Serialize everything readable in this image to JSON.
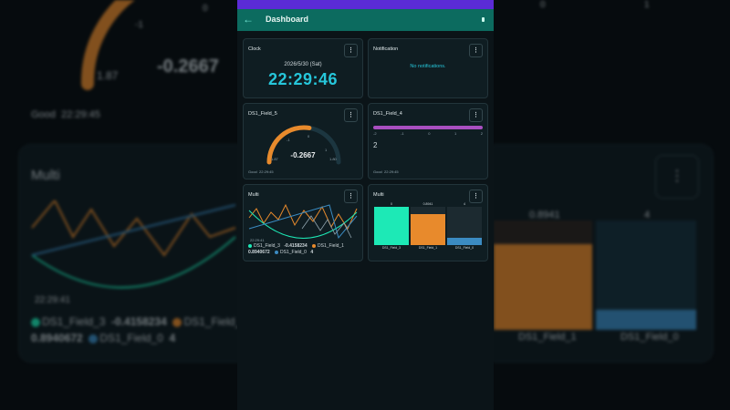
{
  "app": {
    "title": "Dashboard"
  },
  "colors": {
    "teal": "#1de9b6",
    "orange": "#e88a2c",
    "blue": "#3b8bc2",
    "purple": "#a94fc0",
    "accent": "#26c6da"
  },
  "clock": {
    "title": "Clock",
    "date": "2026/5/30 (Sat)",
    "time": "22:29:46"
  },
  "notification": {
    "title": "Notification",
    "empty": "No notifications."
  },
  "gauge": {
    "title": "DS1_Field_5",
    "value": "-0.2667",
    "min": "1.87",
    "max": "1.80",
    "tick_a": "-1",
    "tick_b": "0",
    "tick_c": "1",
    "status": "Good",
    "timestamp": "22:29:45",
    "level": 0.55
  },
  "bar_field": {
    "title": "DS1_Field_4",
    "value": "2",
    "ticks": [
      "-2",
      "-1",
      "0",
      "1",
      "2"
    ],
    "status": "Good",
    "timestamp": "22:29:45"
  },
  "multi_line": {
    "title": "Multi",
    "time_label": "22:29:41",
    "legend": [
      {
        "name": "DS1_Field_3",
        "value": "-0.4158234",
        "color": "#1de9b6"
      },
      {
        "name": "DS1_Field_1",
        "value": "0.8940672",
        "color": "#e88a2c"
      },
      {
        "name": "DS1_Field_0",
        "value": "4",
        "color": "#3b8bc2"
      }
    ]
  },
  "multi_bar": {
    "title": "Multi",
    "bars": [
      {
        "label": "DS1_Field_3",
        "value_label": "0",
        "color": "#1de9b6",
        "fill": 1.0
      },
      {
        "label": "DS1_Field_1",
        "value_label": "0.8941",
        "color": "#e88a2c",
        "fill": 0.8
      },
      {
        "label": "DS1_Field_0",
        "value_label": "4",
        "color": "#3b8bc2",
        "fill": 0.2
      }
    ]
  },
  "background": {
    "gauge_min": "1.87",
    "gauge_tick": "-1",
    "gauge_tick_top": "0",
    "value": "-0.2667",
    "status": "Good",
    "timestamp": "22:29:45",
    "multi_title": "Multi",
    "time_label": "22:29:41",
    "legend_a": "DS1_Field_3",
    "legend_a_val": "-0.4158234",
    "legend_b": "DS1_Field_1",
    "legend_b_val": "0.8940672",
    "legend_c": "DS1_Field_0",
    "legend_c_val": "4",
    "bar_value": "0.8941",
    "bar_value_right": "4",
    "right_top_a": "0",
    "right_top_b": "1",
    "bar_label_b": "DS1_Field_1",
    "bar_label_c": "DS1_Field_0"
  }
}
